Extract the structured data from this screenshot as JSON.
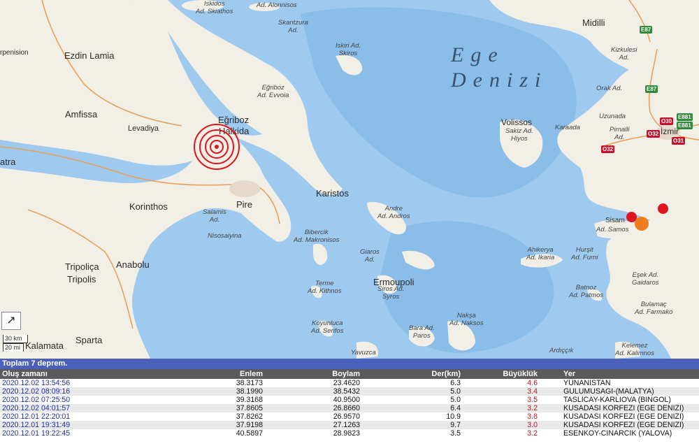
{
  "map": {
    "sea_label_line1": "Ege",
    "sea_label_line2": "Denizi",
    "cities": [
      {
        "name": "city-ezdin-lamia",
        "text": "Ezdin Lamia"
      },
      {
        "name": "city-amfissa",
        "text": "Amfissa"
      },
      {
        "name": "city-levadiya",
        "text": "Levadiya"
      },
      {
        "name": "city-egriboz",
        "text": "Eğriboz"
      },
      {
        "name": "city-halkida",
        "text": "Halkida"
      },
      {
        "name": "city-korinthos",
        "text": "Korinthos"
      },
      {
        "name": "city-pire",
        "text": "Pire"
      },
      {
        "name": "city-karistos",
        "text": "Karistos"
      },
      {
        "name": "city-tripolica",
        "text": "Tripoliça"
      },
      {
        "name": "city-tripolis",
        "text": "Tripolis"
      },
      {
        "name": "city-anabolu",
        "text": "Anabolu"
      },
      {
        "name": "city-sparta",
        "text": "Sparta"
      },
      {
        "name": "city-kalamata",
        "text": "Kalamata"
      },
      {
        "name": "city-ermoupoli",
        "text": "Ermoupoli"
      },
      {
        "name": "city-volissos",
        "text": "Volissos"
      },
      {
        "name": "city-midilli",
        "text": "Midilli"
      },
      {
        "name": "city-izmir",
        "text": "İzmir"
      },
      {
        "name": "city-sisam",
        "text": "Sisam"
      },
      {
        "name": "city-arpenision",
        "text": "rpenision"
      },
      {
        "name": "city-atra",
        "text": "atra"
      }
    ],
    "islands": [
      {
        "name": "island-skiathos",
        "line1": "Iskidos",
        "line2": "Ad. Skiathos"
      },
      {
        "name": "island-alonnisos",
        "line1": "Ad. Alonnisos",
        "line2": ""
      },
      {
        "name": "island-skantzura",
        "line1": "Skantzura",
        "line2": "Ad."
      },
      {
        "name": "island-skiros",
        "line1": "Iskiri Ad.",
        "line2": "Skiros"
      },
      {
        "name": "island-evvoia",
        "line1": "Eğriboz",
        "line2": "Ad. Evvoia"
      },
      {
        "name": "island-andros",
        "line1": "Andre",
        "line2": "Ad. Andros"
      },
      {
        "name": "island-salamis",
        "line1": "Salamis",
        "line2": "Ad."
      },
      {
        "name": "island-nisosaiyina",
        "line1": "Nisosaiyina",
        "line2": ""
      },
      {
        "name": "island-makronisos",
        "line1": "Bibercik",
        "line2": "Ad. Makronisos"
      },
      {
        "name": "island-giaros",
        "line1": "Giaros",
        "line2": "Ad."
      },
      {
        "name": "island-kithnos",
        "line1": "Terme",
        "line2": "Ad. Kithnos"
      },
      {
        "name": "island-siros",
        "line1": "Siros Ad.",
        "line2": "Syros"
      },
      {
        "name": "island-serifos",
        "line1": "Koyunluca",
        "line2": "Ad. Serifos"
      },
      {
        "name": "island-paros",
        "line1": "Bara Ad.",
        "line2": "Paros"
      },
      {
        "name": "island-naksos",
        "line1": "Nakşa",
        "line2": "Ad. Naksos"
      },
      {
        "name": "island-yavuzca",
        "line1": "Yavuzca",
        "line2": ""
      },
      {
        "name": "island-sakiz",
        "line1": "Sakiz Ad.",
        "line2": "Hiyos"
      },
      {
        "name": "island-samos",
        "line1": "Ad. Samos",
        "line2": ""
      },
      {
        "name": "island-ikaria",
        "line1": "Ahikerya",
        "line2": "Ad. Ikaria"
      },
      {
        "name": "island-furni",
        "line1": "Hurşit",
        "line2": "Ad. Furni"
      },
      {
        "name": "island-patmos",
        "line1": "Batnoz",
        "line2": "Ad. Patmos"
      },
      {
        "name": "island-gaidaros",
        "line1": "Eşek Ad.",
        "line2": "Gaidaros"
      },
      {
        "name": "island-farmako",
        "line1": "Bulamaç",
        "line2": "Ad. Farmako"
      },
      {
        "name": "island-arkioi",
        "line1": "Ardıççık",
        "line2": ""
      },
      {
        "name": "island-kalimnos",
        "line1": "Kelemez",
        "line2": "Ad. Kalimnos"
      },
      {
        "name": "place-kizkulesi",
        "line1": "Kizkulesi",
        "line2": "Ad."
      },
      {
        "name": "place-orak",
        "line1": "Orak Ad.",
        "line2": ""
      },
      {
        "name": "place-uzunada",
        "line1": "Uzunada",
        "line2": ""
      },
      {
        "name": "place-karaada",
        "line1": "Karaada",
        "line2": ""
      },
      {
        "name": "place-pirnalli",
        "line1": "Pirnalli",
        "line2": "Ad."
      }
    ],
    "roads": [
      {
        "name": "road-e87-north",
        "text": "E87",
        "color": "green"
      },
      {
        "name": "road-e87-south",
        "text": "E87",
        "color": "green"
      },
      {
        "name": "road-e881",
        "text": "E881",
        "color": "green"
      },
      {
        "name": "road-e881b",
        "text": "E881",
        "color": "green"
      },
      {
        "name": "road-o30",
        "text": "O30",
        "color": "red"
      },
      {
        "name": "road-o32a",
        "text": "O32",
        "color": "red"
      },
      {
        "name": "road-o32b",
        "text": "O32",
        "color": "red"
      },
      {
        "name": "road-o31",
        "text": "O31",
        "color": "red"
      }
    ],
    "scale": {
      "km": "30 km",
      "mi": "20 mi"
    },
    "expand_icon": "arrow-expand-icon"
  },
  "panel": {
    "summary": "Toplam 7 deprem.",
    "columns": {
      "time": "Oluş zamanı",
      "lat": "Enlem",
      "lon": "Boylam",
      "depth": "Der(km)",
      "mag": "Büyüklük",
      "loc": "Yer"
    },
    "rows": [
      {
        "time": "2020.12.02 13:54:56",
        "lat": "38.3173",
        "lon": "23.4620",
        "depth": "6.3",
        "mag": "4.6",
        "loc": "YUNANISTAN"
      },
      {
        "time": "2020.12.02 08:09:16",
        "lat": "38.1990",
        "lon": "38.5432",
        "depth": "5.0",
        "mag": "3.4",
        "loc": "GULUMUSAGI-(MALATYA)"
      },
      {
        "time": "2020.12.02 07:25:50",
        "lat": "39.3168",
        "lon": "40.9500",
        "depth": "5.0",
        "mag": "3.5",
        "loc": "TASLICAY-KARLIOVA (BINGOL)"
      },
      {
        "time": "2020.12.02 04:01:57",
        "lat": "37.8605",
        "lon": "26.8660",
        "depth": "6.4",
        "mag": "3.2",
        "loc": "KUSADASI KORFEZI (EGE DENIZI)"
      },
      {
        "time": "2020.12.01 22:20:01",
        "lat": "37.8262",
        "lon": "26.9570",
        "depth": "10.9",
        "mag": "3.8",
        "loc": "KUSADASI KORFEZI (EGE DENIZI)"
      },
      {
        "time": "2020.12.01 19:31:49",
        "lat": "37.9198",
        "lon": "27.1263",
        "depth": "9.7",
        "mag": "3.0",
        "loc": "KUSADASI KORFEZI (EGE DENIZI)"
      },
      {
        "time": "2020.12.01 19:22:45",
        "lat": "40.5897",
        "lon": "28.9823",
        "depth": "3.5",
        "mag": "3.2",
        "loc": "ESENKOY-CINARCIK (YALOVA)"
      }
    ]
  },
  "colors": {
    "land": "#f1efe6",
    "sea": "#9fcaef",
    "deep_sea": "#8bbde9",
    "quake_major": "#e0141e",
    "quake_small_red": "#e0141e",
    "quake_orange": "#ef7d1d",
    "header_blue": "#4b61b9",
    "header_gray": "#5a5a5a"
  }
}
